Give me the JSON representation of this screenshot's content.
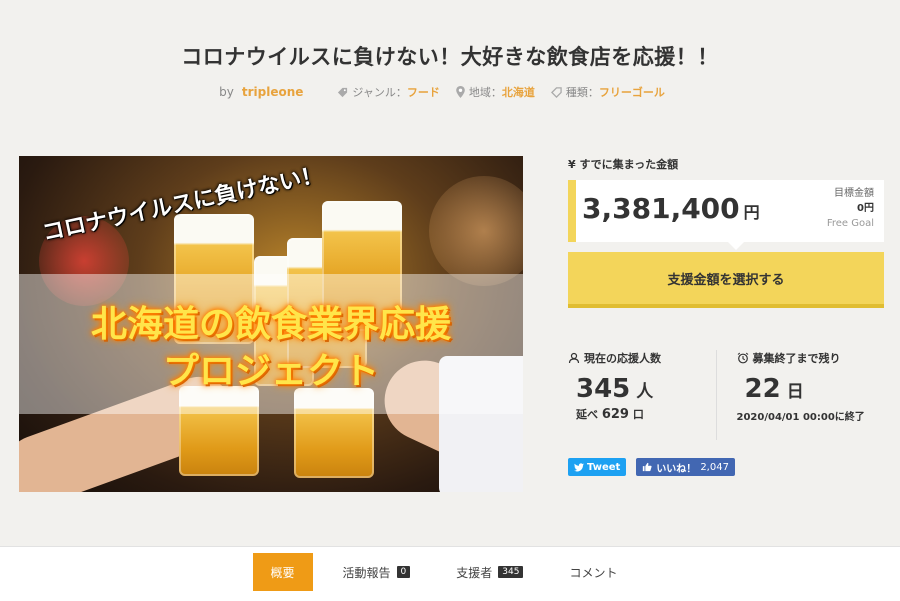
{
  "project": {
    "title": "コロナウイルスに負けない！大好きな飲食店を応援！！",
    "by_label": "by",
    "owner": "tripleone",
    "genre_label": "ジャンル：",
    "genre": "フード",
    "region_label": "地域：",
    "region": "北海道",
    "type_label": "種類：",
    "type": "フリーゴール"
  },
  "hero": {
    "caption_top": "コロナウイルスに負けない！",
    "caption_line1": "北海道の飲食業界応援",
    "caption_line2": "プロジェクト"
  },
  "funding": {
    "collected_label": "¥ すでに集まった金額",
    "amount": "3,381,400",
    "unit": "円",
    "goal_label": "目標金額",
    "goal_value": "0円",
    "goal_type": "Free Goal",
    "support_button": "支援金額を選択する"
  },
  "stats": {
    "supporters_label": "現在の応援人数",
    "supporters": "345",
    "supporters_unit": "人",
    "total_label": "延べ",
    "total": "629",
    "total_unit": "口",
    "remaining_label": "募集終了まで残り",
    "remaining": "22",
    "remaining_unit": "日",
    "end_text": "2020/04/01 00:00に終了"
  },
  "social": {
    "tweet": "Tweet",
    "like_label": "いいね！",
    "like_count": "2,047"
  },
  "tabs": [
    {
      "label": "概要"
    },
    {
      "label": "活動報告",
      "count": "0"
    },
    {
      "label": "支援者",
      "count": "345"
    },
    {
      "label": "コメント"
    }
  ],
  "colors": {
    "accent_orange": "#ef9b16",
    "link_orange": "#e8a33d",
    "support_yellow": "#f3d55a",
    "twitter_blue": "#1da1f2",
    "facebook_blue": "#4267b2"
  }
}
